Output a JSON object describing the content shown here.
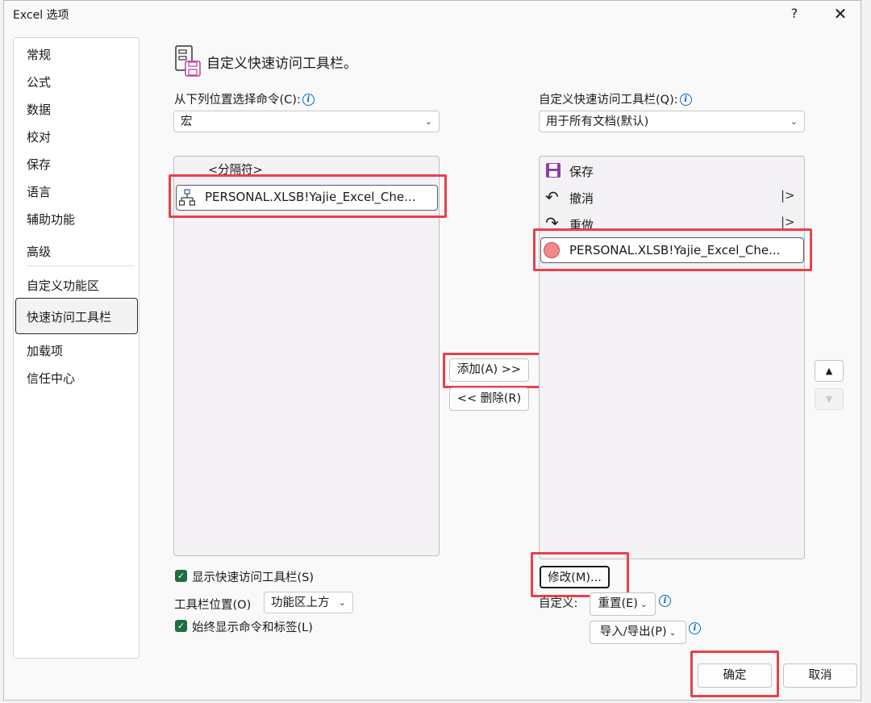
{
  "dialog": {
    "title": "Excel 选项",
    "help": "?",
    "close": "✕"
  },
  "nav": {
    "items": [
      "常规",
      "公式",
      "数据",
      "校对",
      "保存",
      "语言",
      "辅助功能",
      "高级",
      "自定义功能区",
      "快速访问工具栏",
      "加载项",
      "信任中心"
    ],
    "selected": "快速访问工具栏"
  },
  "heading": "自定义快速访问工具栏。",
  "left_pane": {
    "choose_label": "从下列位置选择命令(C):",
    "choose_value": "宏",
    "commands": [
      "<分隔符>",
      "PERSONAL.XLSB!Yajie_Excel_Che..."
    ]
  },
  "right_pane": {
    "customize_label": "自定义快速访问工具栏(Q):",
    "customize_value": "用于所有文档(默认)",
    "items": [
      {
        "label": "保存",
        "icon": "save-icon"
      },
      {
        "label": "撤消",
        "icon": "undo-icon",
        "has_arrow": true
      },
      {
        "label": "重做",
        "icon": "redo-icon",
        "has_arrow": true
      },
      {
        "label": "PERSONAL.XLSB!Yajie_Excel_Che...",
        "icon": "macro-circle-icon"
      }
    ]
  },
  "buttons": {
    "add": "添加(A) >>",
    "remove": "<< 删除(R)",
    "modify": "修改(M)...",
    "reset": "重置(E)",
    "import_export": "导入/导出(P)",
    "ok": "确定",
    "cancel": "取消",
    "move_up": "▲",
    "move_down": "▼"
  },
  "options": {
    "show_qat": "显示快速访问工具栏(S)",
    "toolbar_position_label": "工具栏位置(O)",
    "toolbar_position_value": "功能区上方",
    "always_show_labels": "始终显示命令和标签(L)",
    "customize_label": "自定义:"
  },
  "colors": {
    "highlight_box": "#e8404c",
    "checkbox": "#1e6e3f",
    "info": "#0067c0",
    "macro_circle": "#f08a8a"
  }
}
